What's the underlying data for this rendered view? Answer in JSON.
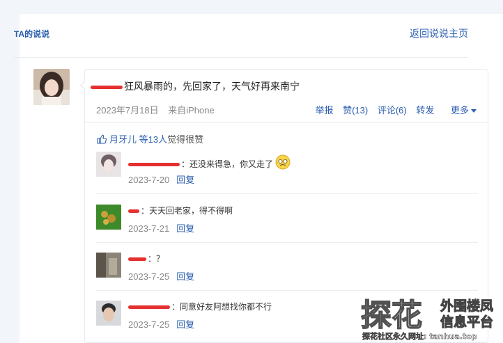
{
  "header": {
    "title": "TA的说说",
    "back_link": "返回说说主页"
  },
  "post": {
    "text": "狂风暴雨的，先回家了，天气好再来南宁",
    "date": "2023年7月18日",
    "source": "来自iPhone",
    "actions": {
      "report": "举报",
      "like": "赞(13)",
      "comment": "评论(6)",
      "forward": "转发",
      "more": "更多"
    }
  },
  "likes": {
    "user": "月牙儿",
    "count_text": "等13人",
    "suffix": "觉得很赞"
  },
  "comments": [
    {
      "text": "：还没来得急，你又走了",
      "date": "2023-7-20",
      "reply": "回复"
    },
    {
      "text": "：天天回老家，得不得啊",
      "date": "2023-7-21",
      "reply": "回复"
    },
    {
      "text": "：？",
      "date": "2023-7-25",
      "reply": "回复"
    },
    {
      "text": "：同意好友阿想找你都不行",
      "date": "2023-7-25",
      "reply": "回复"
    }
  ],
  "watermark": {
    "logo_text": "探花",
    "line1": "外围楼凤",
    "line2": "信息平台",
    "url_text": "探花社区永久网址: tanhua.top"
  },
  "colors": {
    "link": "#2a5db0",
    "redaction": "#e53030",
    "background": "#f2f5fa"
  }
}
